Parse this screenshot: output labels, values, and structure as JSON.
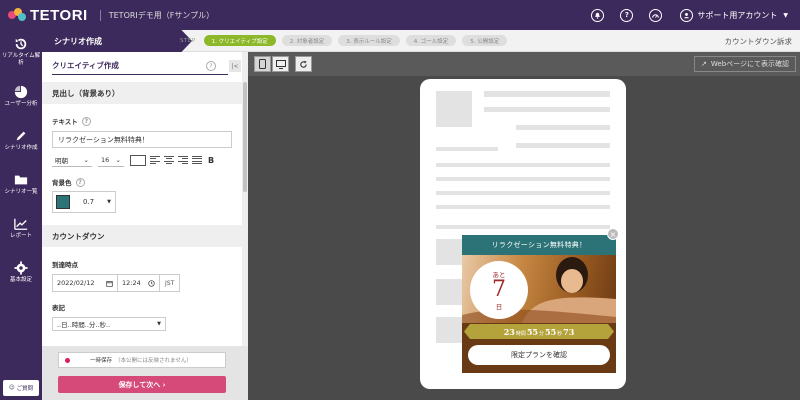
{
  "app": {
    "logo": "TETORI",
    "title": "TETORIデモ用（Fサンプル）"
  },
  "topbar": {
    "account_label": "サポート用アカウント"
  },
  "nav": {
    "items": [
      {
        "label": "リアルタイム解析",
        "icon": "realtime-icon"
      },
      {
        "label": "ユーザー分析",
        "icon": "pie-chart-icon"
      },
      {
        "label": "シナリオ作成",
        "icon": "pencil-icon"
      },
      {
        "label": "シナリオ一覧",
        "icon": "folder-icon"
      },
      {
        "label": "レポート",
        "icon": "line-chart-icon"
      },
      {
        "label": "基本設定",
        "icon": "gear-icon"
      }
    ],
    "help_label": "ご質問"
  },
  "header": {
    "title": "シナリオ作成",
    "step_label": "STEP",
    "steps": [
      "1. クリエイティブ設定",
      "2. 対象者設定",
      "3. 表示ルール設定",
      "4. ゴール設定",
      "5. 公開設定"
    ],
    "active_step": 0,
    "right_text": "カウントダウン訴求"
  },
  "editor": {
    "panel_title": "クリエイティブ作成",
    "heading_section": "見出し（背景あり）",
    "text_label": "テキスト",
    "text_value": "リラクゼーション無料特典！",
    "font_family": "明朝",
    "font_size": "16",
    "bg_color_label": "背景色",
    "bg_color": "#2c7377",
    "bg_opacity": "0.7",
    "countdown_section": "カウントダウン",
    "deadline_label": "到達時点",
    "date_value": "2022/02/12",
    "time_value": "12:24",
    "tz": "JST",
    "notation_label": "表記",
    "notation_value": "..日..時間..分..秒.."
  },
  "footer": {
    "temp_save": "一時保存",
    "temp_save_note": "（本公開には反映されません）",
    "save_next": "保存して次へ ›"
  },
  "preview": {
    "web_button": "Webページにて表示確認",
    "popup": {
      "title": "リラクゼーション無料特典！",
      "countdown_prefix": "あと",
      "countdown_days": "7",
      "countdown_unit": "日",
      "timer": {
        "hours": "23",
        "minutes": "55",
        "seconds": "55",
        "centis": "73",
        "hours_label": "時間",
        "minutes_label": "分",
        "seconds_label": "秒"
      },
      "button": "限定プランを確認"
    }
  }
}
